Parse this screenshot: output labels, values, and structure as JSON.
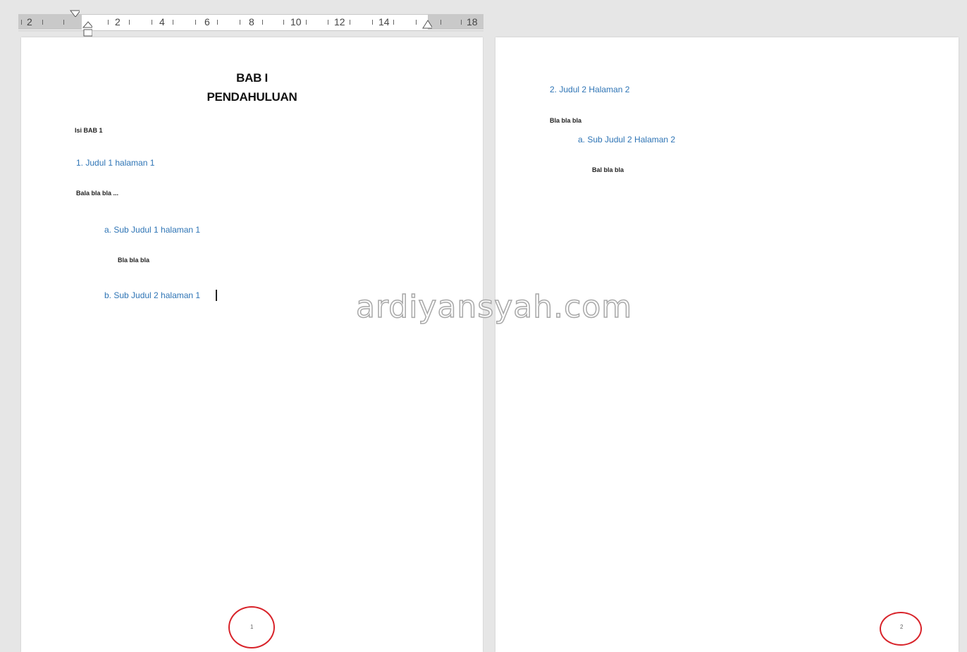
{
  "ruler": {
    "left_label": "2",
    "numbers": [
      "2",
      "4",
      "6",
      "8",
      "10",
      "12",
      "14",
      "18"
    ]
  },
  "page1": {
    "chapter_number": "BAB I",
    "chapter_title": "PENDAHULUAN",
    "intro": "Isi BAB 1",
    "heading1": "1.  Judul 1 halaman 1",
    "para1": "Bala bla bla ...",
    "sub_a": "a.  Sub Judul 1 halaman 1",
    "sub_a_text": "Bla bla bla",
    "sub_b": "b.  Sub Judul 2 halaman 1",
    "page_number": "1"
  },
  "page2": {
    "heading2": "2.  Judul 2 Halaman 2",
    "para2": "Bla bla bla",
    "sub_a": "a.  Sub Judul 2 Halaman 2",
    "sub_a_text": "Bal bla bla",
    "page_number": "2"
  },
  "watermark": "ardiyansyah.com",
  "colors": {
    "heading_blue": "#2e74b5",
    "annotation_red": "#d8232a",
    "background": "#e6e6e6"
  }
}
